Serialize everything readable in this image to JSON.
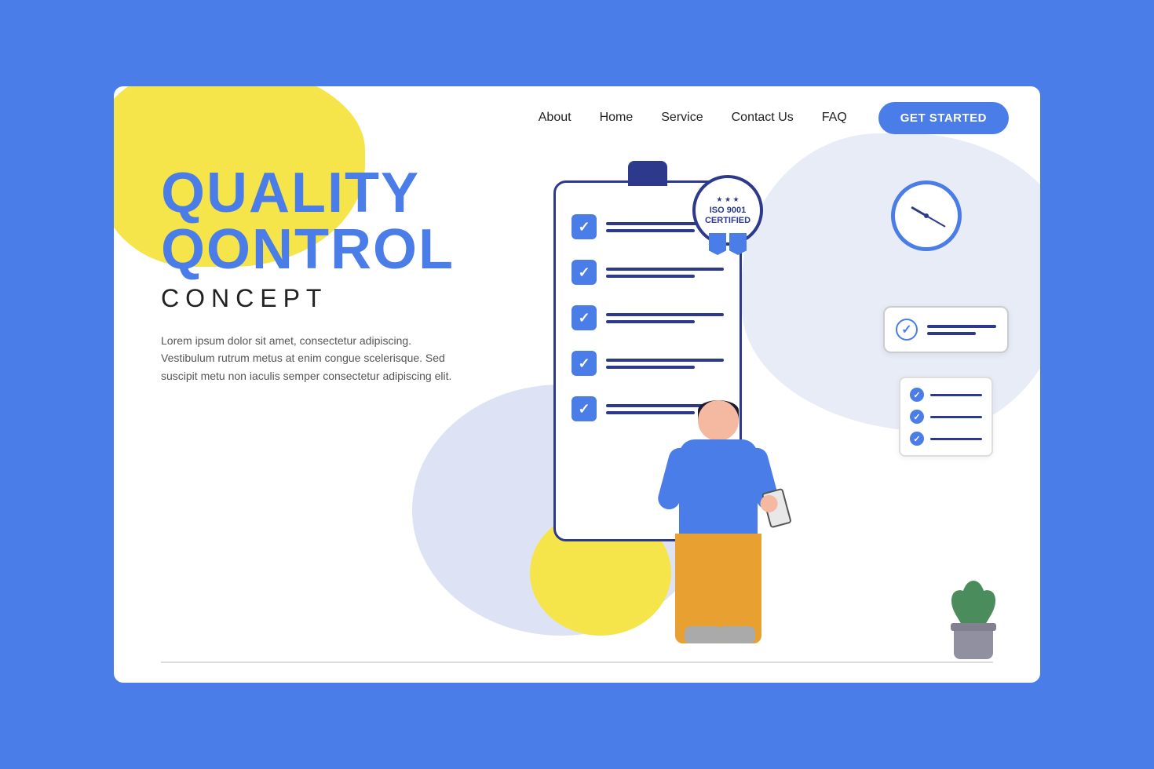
{
  "page": {
    "bg_color": "#4a7de8"
  },
  "nav": {
    "links": [
      {
        "id": "about",
        "label": "About"
      },
      {
        "id": "home",
        "label": "Home"
      },
      {
        "id": "service",
        "label": "Service"
      },
      {
        "id": "contact",
        "label": "Contact Us"
      },
      {
        "id": "faq",
        "label": "FAQ"
      }
    ],
    "cta_label": "GET STARTED"
  },
  "hero": {
    "title_line1": "QUALITY",
    "title_line2": "QONTROL",
    "subtitle": "CONCEPT",
    "body_text": "Lorem ipsum dolor sit amet, consectetur adipiscing. Vestibulum rutrum metus at enim congue scelerisque. Sed suscipit metu non iaculis semper consectetur adipiscing elit."
  },
  "iso_badge": {
    "stars": "★ ★ ★",
    "line1": "ISO 9001",
    "line2": "CERTIFIED"
  }
}
